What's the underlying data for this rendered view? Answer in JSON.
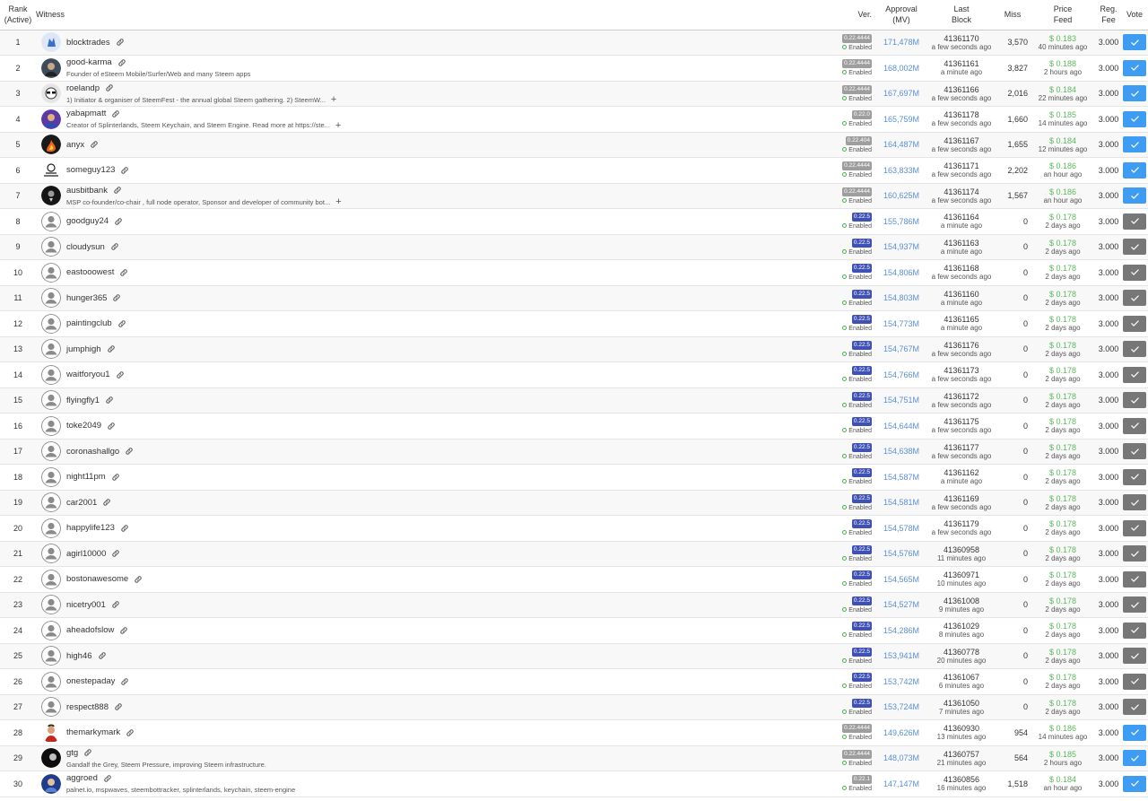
{
  "colors": {
    "ver_gray": "#9e9e9e",
    "ver_blue": "#3f51b5",
    "approval": "#5a8fd8",
    "feed": "#5cb85c",
    "vote_active": "#3e9cf2",
    "vote_inactive": "#777777"
  },
  "headers": {
    "rank_l1": "Rank",
    "rank_l2": "(Active)",
    "witness": "Witness",
    "ver": "Ver.",
    "approval_l1": "Approval",
    "approval_l2": "(MV)",
    "last_l1": "Last",
    "last_l2": "Block",
    "miss": "Miss",
    "feed_l1": "Price",
    "feed_l2": "Feed",
    "fee_l1": "Reg.",
    "fee_l2": "Fee",
    "vote": "Vote"
  },
  "enabled_label": "Enabled",
  "rows": [
    {
      "rank": "1",
      "name": "blocktrades",
      "desc": "",
      "ver": "0.22.4444",
      "ver_color": "gray",
      "approval": "171,478M",
      "block": "41361170",
      "block_time": "a few seconds ago",
      "miss": "3,570",
      "feed": "$ 0.183",
      "feed_time": "40 minutes ago",
      "fee": "3.000",
      "voted": true,
      "avatar": "blue-wolf"
    },
    {
      "rank": "2",
      "name": "good-karma",
      "desc": "Founder of eSteem Mobile/Surfer/Web and many Steem apps",
      "ver": "0.22.4444",
      "ver_color": "gray",
      "approval": "168,002M",
      "block": "41361161",
      "block_time": "a minute ago",
      "miss": "3,827",
      "feed": "$ 0.188",
      "feed_time": "2 hours ago",
      "fee": "3.000",
      "voted": true,
      "avatar": "person"
    },
    {
      "rank": "3",
      "name": "roelandp",
      "desc": "1) Initiator & organiser of SteemFest - the annual global Steem gathering. 2) SteemW...",
      "ver": "0.22.4444",
      "ver_color": "gray",
      "approval": "167,697M",
      "block": "41361166",
      "block_time": "a few seconds ago",
      "miss": "2,016",
      "feed": "$ 0.184",
      "feed_time": "22 minutes ago",
      "fee": "3.000",
      "voted": true,
      "avatar": "sunglasses",
      "plus": true
    },
    {
      "rank": "4",
      "name": "yabapmatt",
      "desc": "Creator of Splinterlands, Steem Keychain, and Steem Engine. Read more at https://ste...",
      "ver": "0.22.0",
      "ver_color": "gray",
      "approval": "165,759M",
      "block": "41361178",
      "block_time": "a few seconds ago",
      "miss": "1,660",
      "feed": "$ 0.185",
      "feed_time": "14 minutes ago",
      "fee": "3.000",
      "voted": true,
      "avatar": "purple",
      "plus": true
    },
    {
      "rank": "5",
      "name": "anyx",
      "desc": "",
      "ver": "0.22.404",
      "ver_color": "gray",
      "approval": "164,487M",
      "block": "41361167",
      "block_time": "a few seconds ago",
      "miss": "1,655",
      "feed": "$ 0.184",
      "feed_time": "12 minutes ago",
      "fee": "3.000",
      "voted": true,
      "avatar": "fire"
    },
    {
      "rank": "6",
      "name": "someguy123",
      "desc": "",
      "ver": "0.22.4444",
      "ver_color": "gray",
      "approval": "163,833M",
      "block": "41361171",
      "block_time": "a few seconds ago",
      "miss": "2,202",
      "feed": "$ 0.186",
      "feed_time": "an hour ago",
      "fee": "3.000",
      "voted": true,
      "avatar": "sketch"
    },
    {
      "rank": "7",
      "name": "ausbitbank",
      "desc": "MSP co-founder/co-chair , full node operator, Sponsor and developer of community bot...",
      "ver": "0.22.4444",
      "ver_color": "gray",
      "approval": "160,625M",
      "block": "41361174",
      "block_time": "a few seconds ago",
      "miss": "1,567",
      "feed": "$ 0.186",
      "feed_time": "an hour ago",
      "fee": "3.000",
      "voted": true,
      "avatar": "dark",
      "plus": true
    },
    {
      "rank": "8",
      "name": "goodguy24",
      "desc": "",
      "ver": "0.22.5",
      "ver_color": "blue",
      "approval": "155,786M",
      "block": "41361164",
      "block_time": "a minute ago",
      "miss": "0",
      "feed": "$ 0.178",
      "feed_time": "2 days ago",
      "fee": "3.000",
      "voted": false,
      "avatar": "default"
    },
    {
      "rank": "9",
      "name": "cloudysun",
      "desc": "",
      "ver": "0.22.5",
      "ver_color": "blue",
      "approval": "154,937M",
      "block": "41361163",
      "block_time": "a minute ago",
      "miss": "0",
      "feed": "$ 0.178",
      "feed_time": "2 days ago",
      "fee": "3.000",
      "voted": false,
      "avatar": "default"
    },
    {
      "rank": "10",
      "name": "eastooowest",
      "desc": "",
      "ver": "0.22.5",
      "ver_color": "blue",
      "approval": "154,806M",
      "block": "41361168",
      "block_time": "a few seconds ago",
      "miss": "0",
      "feed": "$ 0.178",
      "feed_time": "2 days ago",
      "fee": "3.000",
      "voted": false,
      "avatar": "default"
    },
    {
      "rank": "11",
      "name": "hunger365",
      "desc": "",
      "ver": "0.22.5",
      "ver_color": "blue",
      "approval": "154,803M",
      "block": "41361160",
      "block_time": "a minute ago",
      "miss": "0",
      "feed": "$ 0.178",
      "feed_time": "2 days ago",
      "fee": "3.000",
      "voted": false,
      "avatar": "default"
    },
    {
      "rank": "12",
      "name": "paintingclub",
      "desc": "",
      "ver": "0.22.5",
      "ver_color": "blue",
      "approval": "154,773M",
      "block": "41361165",
      "block_time": "a minute ago",
      "miss": "0",
      "feed": "$ 0.178",
      "feed_time": "2 days ago",
      "fee": "3.000",
      "voted": false,
      "avatar": "default"
    },
    {
      "rank": "13",
      "name": "jumphigh",
      "desc": "",
      "ver": "0.22.5",
      "ver_color": "blue",
      "approval": "154,767M",
      "block": "41361176",
      "block_time": "a few seconds ago",
      "miss": "0",
      "feed": "$ 0.178",
      "feed_time": "2 days ago",
      "fee": "3.000",
      "voted": false,
      "avatar": "default"
    },
    {
      "rank": "14",
      "name": "waitforyou1",
      "desc": "",
      "ver": "0.22.5",
      "ver_color": "blue",
      "approval": "154,766M",
      "block": "41361173",
      "block_time": "a few seconds ago",
      "miss": "0",
      "feed": "$ 0.178",
      "feed_time": "2 days ago",
      "fee": "3.000",
      "voted": false,
      "avatar": "default"
    },
    {
      "rank": "15",
      "name": "flyingfly1",
      "desc": "",
      "ver": "0.22.5",
      "ver_color": "blue",
      "approval": "154,751M",
      "block": "41361172",
      "block_time": "a few seconds ago",
      "miss": "0",
      "feed": "$ 0.178",
      "feed_time": "2 days ago",
      "fee": "3.000",
      "voted": false,
      "avatar": "default"
    },
    {
      "rank": "16",
      "name": "toke2049",
      "desc": "",
      "ver": "0.22.5",
      "ver_color": "blue",
      "approval": "154,644M",
      "block": "41361175",
      "block_time": "a few seconds ago",
      "miss": "0",
      "feed": "$ 0.178",
      "feed_time": "2 days ago",
      "fee": "3.000",
      "voted": false,
      "avatar": "default"
    },
    {
      "rank": "17",
      "name": "coronashallgo",
      "desc": "",
      "ver": "0.22.5",
      "ver_color": "blue",
      "approval": "154,638M",
      "block": "41361177",
      "block_time": "a few seconds ago",
      "miss": "0",
      "feed": "$ 0.178",
      "feed_time": "2 days ago",
      "fee": "3.000",
      "voted": false,
      "avatar": "default"
    },
    {
      "rank": "18",
      "name": "night11pm",
      "desc": "",
      "ver": "0.22.5",
      "ver_color": "blue",
      "approval": "154,587M",
      "block": "41361162",
      "block_time": "a minute ago",
      "miss": "0",
      "feed": "$ 0.178",
      "feed_time": "2 days ago",
      "fee": "3.000",
      "voted": false,
      "avatar": "default"
    },
    {
      "rank": "19",
      "name": "car2001",
      "desc": "",
      "ver": "0.22.5",
      "ver_color": "blue",
      "approval": "154,581M",
      "block": "41361169",
      "block_time": "a few seconds ago",
      "miss": "0",
      "feed": "$ 0.178",
      "feed_time": "2 days ago",
      "fee": "3.000",
      "voted": false,
      "avatar": "default"
    },
    {
      "rank": "20",
      "name": "happylife123",
      "desc": "",
      "ver": "0.22.5",
      "ver_color": "blue",
      "approval": "154,578M",
      "block": "41361179",
      "block_time": "a few seconds ago",
      "miss": "0",
      "feed": "$ 0.178",
      "feed_time": "2 days ago",
      "fee": "3.000",
      "voted": false,
      "avatar": "default"
    },
    {
      "rank": "21",
      "name": "agirl10000",
      "desc": "",
      "ver": "0.22.5",
      "ver_color": "blue",
      "approval": "154,576M",
      "block": "41360958",
      "block_time": "11 minutes ago",
      "miss": "0",
      "feed": "$ 0.178",
      "feed_time": "2 days ago",
      "fee": "3.000",
      "voted": false,
      "avatar": "default"
    },
    {
      "rank": "22",
      "name": "bostonawesome",
      "desc": "",
      "ver": "0.22.5",
      "ver_color": "blue",
      "approval": "154,565M",
      "block": "41360971",
      "block_time": "10 minutes ago",
      "miss": "0",
      "feed": "$ 0.178",
      "feed_time": "2 days ago",
      "fee": "3.000",
      "voted": false,
      "avatar": "default"
    },
    {
      "rank": "23",
      "name": "nicetry001",
      "desc": "",
      "ver": "0.22.5",
      "ver_color": "blue",
      "approval": "154,527M",
      "block": "41361008",
      "block_time": "9 minutes ago",
      "miss": "0",
      "feed": "$ 0.178",
      "feed_time": "2 days ago",
      "fee": "3.000",
      "voted": false,
      "avatar": "default"
    },
    {
      "rank": "24",
      "name": "aheadofslow",
      "desc": "",
      "ver": "0.22.5",
      "ver_color": "blue",
      "approval": "154,286M",
      "block": "41361029",
      "block_time": "8 minutes ago",
      "miss": "0",
      "feed": "$ 0.178",
      "feed_time": "2 days ago",
      "fee": "3.000",
      "voted": false,
      "avatar": "default"
    },
    {
      "rank": "25",
      "name": "high46",
      "desc": "",
      "ver": "0.22.5",
      "ver_color": "blue",
      "approval": "153,941M",
      "block": "41360778",
      "block_time": "20 minutes ago",
      "miss": "0",
      "feed": "$ 0.178",
      "feed_time": "2 days ago",
      "fee": "3.000",
      "voted": false,
      "avatar": "default"
    },
    {
      "rank": "26",
      "name": "onestepaday",
      "desc": "",
      "ver": "0.22.5",
      "ver_color": "blue",
      "approval": "153,742M",
      "block": "41361067",
      "block_time": "6 minutes ago",
      "miss": "0",
      "feed": "$ 0.178",
      "feed_time": "2 days ago",
      "fee": "3.000",
      "voted": false,
      "avatar": "default"
    },
    {
      "rank": "27",
      "name": "respect888",
      "desc": "",
      "ver": "0.22.5",
      "ver_color": "blue",
      "approval": "153,724M",
      "block": "41361050",
      "block_time": "7 minutes ago",
      "miss": "0",
      "feed": "$ 0.178",
      "feed_time": "2 days ago",
      "fee": "3.000",
      "voted": false,
      "avatar": "default"
    },
    {
      "rank": "28",
      "name": "themarkymark",
      "desc": "",
      "ver": "0.22.4444",
      "ver_color": "gray",
      "approval": "149,626M",
      "block": "41360930",
      "block_time": "13 minutes ago",
      "miss": "954",
      "feed": "$ 0.186",
      "feed_time": "14 minutes ago",
      "fee": "3.000",
      "voted": true,
      "avatar": "red"
    },
    {
      "rank": "29",
      "name": "gtg",
      "desc": "Gandalf the Grey, Steem Pressure, improving Steem infrastructure.",
      "ver": "0.22.4444",
      "ver_color": "gray",
      "approval": "148,073M",
      "block": "41360757",
      "block_time": "21 minutes ago",
      "miss": "564",
      "feed": "$ 0.185",
      "feed_time": "2 hours ago",
      "fee": "3.000",
      "voted": true,
      "avatar": "dark2"
    },
    {
      "rank": "30",
      "name": "aggroed",
      "desc": "palnet.io, mspwaves, steembottracker, splinterlands, keychain, steem-engine",
      "ver": "0.22.1",
      "ver_color": "gray",
      "approval": "147,147M",
      "block": "41360856",
      "block_time": "16 minutes ago",
      "miss": "1,518",
      "feed": "$ 0.184",
      "feed_time": "an hour ago",
      "fee": "3.000",
      "voted": true,
      "avatar": "blue2"
    }
  ]
}
